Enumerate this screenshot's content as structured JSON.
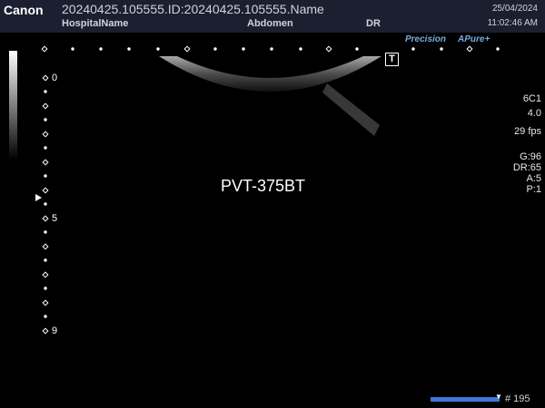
{
  "header": {
    "brand": "Canon",
    "patient_line": "20240425.105555.ID:20240425.105555.Name",
    "hospital": "HospitalName",
    "exam": "Abdomen",
    "mode": "DR",
    "date": "25/04/2024",
    "time": "11:02:46 AM"
  },
  "badges": {
    "precision": "Precision",
    "apure": "APure+",
    "t_marker": "T"
  },
  "params": {
    "probe": "6C1",
    "frequency": "4.0",
    "frame_rate": "29 fps",
    "gain": "G:96",
    "dynamic_range": "DR:65",
    "a_value": "A:5",
    "p_value": "P:1"
  },
  "image": {
    "label": "PVT-375BT"
  },
  "depth_scale": {
    "marks": [
      "0",
      "5",
      "9"
    ]
  },
  "cine": {
    "frame": "# 195"
  }
}
